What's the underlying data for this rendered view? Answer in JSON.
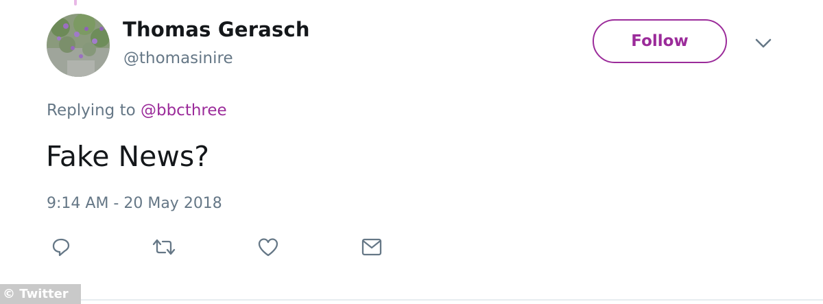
{
  "tweet": {
    "author_name": "Thomas Gerasch",
    "author_handle": "@thomasinire",
    "follow_label": "Follow",
    "replying_prefix": "Replying to",
    "replying_to": "@bbcthree",
    "text": "Fake News?",
    "timestamp": "9:14 AM - 20 May 2018"
  },
  "actions": {
    "reply_icon": "reply-icon",
    "retweet_icon": "retweet-icon",
    "like_icon": "heart-icon",
    "dm_icon": "envelope-icon"
  },
  "watermark": "© Twitter",
  "colors": {
    "accent": "#9b2b9a",
    "secondary_text": "#657786",
    "primary_text": "#14171a"
  }
}
